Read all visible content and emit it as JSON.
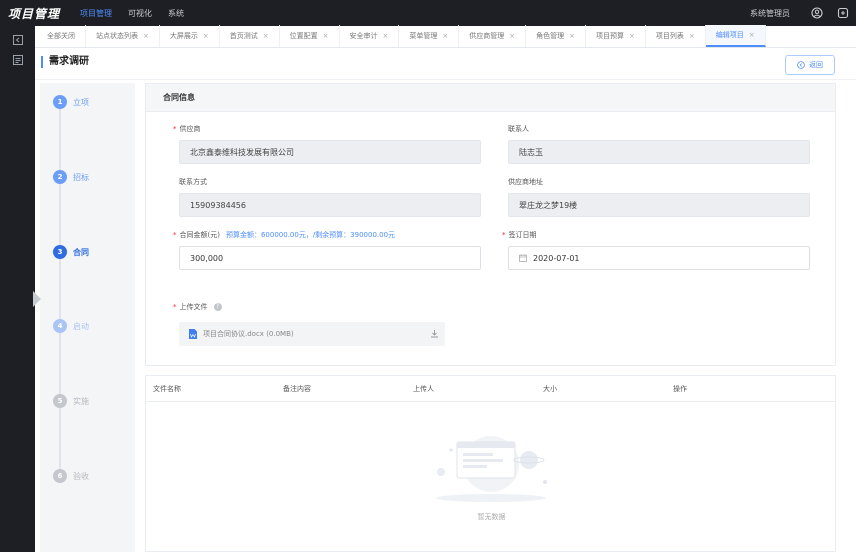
{
  "app": {
    "logo": "项目管理",
    "top_nav": [
      {
        "label": "项目管理",
        "active": true
      },
      {
        "label": "可视化",
        "active": false
      },
      {
        "label": "系统",
        "active": false
      }
    ],
    "admin_name": "系统管理员"
  },
  "tabs": [
    {
      "label": "全部关闭",
      "closable": false
    },
    {
      "label": "站点状态列表",
      "closable": true
    },
    {
      "label": "大屏展示",
      "closable": true
    },
    {
      "label": "首页测试",
      "closable": true
    },
    {
      "label": "位置配置",
      "closable": true
    },
    {
      "label": "安全审计",
      "closable": true
    },
    {
      "label": "菜单管理",
      "closable": true
    },
    {
      "label": "供应商管理",
      "closable": true
    },
    {
      "label": "角色管理",
      "closable": true
    },
    {
      "label": "项目预算",
      "closable": true
    },
    {
      "label": "项目列表",
      "closable": true
    },
    {
      "label": "编辑项目",
      "closable": true,
      "active": true
    }
  ],
  "tab_close_glyph": "×",
  "page": {
    "title": "需求调研",
    "back_label": "返回"
  },
  "steps": [
    {
      "num": "1",
      "label": "立项",
      "state": "done"
    },
    {
      "num": "2",
      "label": "招标",
      "state": "done"
    },
    {
      "num": "3",
      "label": "合同",
      "state": "current"
    },
    {
      "num": "4",
      "label": "启动",
      "state": "todo-near"
    },
    {
      "num": "5",
      "label": "实施",
      "state": "todo"
    },
    {
      "num": "6",
      "label": "验收",
      "state": "todo"
    }
  ],
  "contract": {
    "section_title": "合同信息",
    "required_mark": "*",
    "supplier": {
      "label": "供应商",
      "value": "北京鑫泰维科技发展有限公司"
    },
    "contact_person": {
      "label": "联系人",
      "value": "陆志玉"
    },
    "contact_info": {
      "label": "联系方式",
      "value": "15909384456"
    },
    "supplier_address": {
      "label": "供应商地址",
      "value": "翠庄龙之梦19楼"
    },
    "amount": {
      "label": "合同金额(元)",
      "hint": "预算金额：600000.00元，/剩余预算：390000.00元",
      "value": "300,000"
    },
    "sign_date": {
      "label": "签订日期",
      "value": "2020-07-01"
    },
    "upload": {
      "label": "上传文件",
      "info_glyph": "?"
    },
    "file": {
      "name": "项目合同协议.docx",
      "size": "(0.0MB)"
    }
  },
  "table": {
    "columns": [
      "文件名称",
      "备注内容",
      "上传人",
      "大小",
      "操作"
    ],
    "empty_text": "暂无数据"
  },
  "colors": {
    "accent": "#4d8dfc",
    "topbar": "#1d1f24",
    "required": "#f5222d"
  }
}
